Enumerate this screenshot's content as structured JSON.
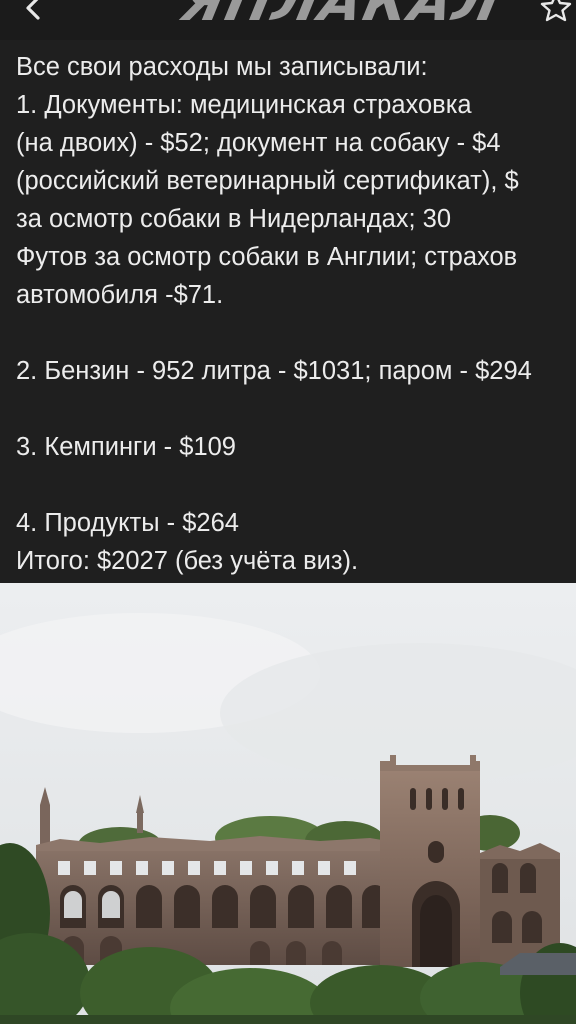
{
  "header": {
    "logo_text": "ЯПЛАКАЛ",
    "back_icon": "chevron-left-icon",
    "star_icon": "star-outline-icon"
  },
  "post": {
    "lines": [
      "Все свои расходы мы записывали:",
      "1. Документы: медицинская страховка",
      "(на двоих) - $52; документ на собаку - $4",
      "(российский ветеринарный сертификат), $",
      "за осмотр собаки в Нидерландах; 30",
      "Футов за осмотр собаки в Англии; страхов",
      "автомобиля -$71.",
      "2. Бензин - 952 литра - $1031; паром - $294",
      "3. Кемпинги - $109",
      "4. Продукты - $264",
      "Итого: $2027 (без учёта виз)."
    ]
  },
  "photo": {
    "subject": "abbey-ruins-photo"
  },
  "colors": {
    "background": "#1f1f1f",
    "text": "#ececec",
    "logo": "#9a9a9a"
  }
}
